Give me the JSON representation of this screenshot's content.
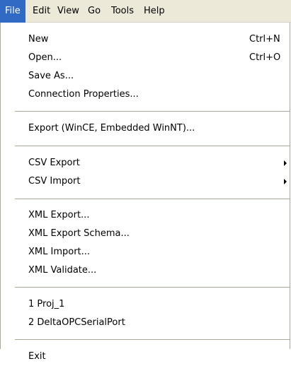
{
  "menubar": {
    "items": [
      {
        "label": "File",
        "active": true
      },
      {
        "label": "Edit"
      },
      {
        "label": "View"
      },
      {
        "label": "Go"
      },
      {
        "label": "Tools"
      },
      {
        "label": "Help"
      }
    ]
  },
  "file_menu": {
    "new": {
      "label": "New",
      "shortcut": "Ctrl+N"
    },
    "open": {
      "label": "Open...",
      "shortcut": "Ctrl+O"
    },
    "save_as": {
      "label": "Save As..."
    },
    "connection_properties": {
      "label": "Connection Properties..."
    },
    "export_wince": {
      "label": "Export (WinCE, Embedded WinNT)..."
    },
    "csv_export": {
      "label": "CSV Export"
    },
    "csv_import": {
      "label": "CSV Import"
    },
    "xml_export": {
      "label": "XML Export..."
    },
    "xml_export_schema": {
      "label": "XML Export Schema..."
    },
    "xml_import": {
      "label": "XML Import..."
    },
    "xml_validate": {
      "label": "XML Validate..."
    },
    "recent_1": {
      "label": "1 Proj_1"
    },
    "recent_2": {
      "label": "2 DeltaOPCSerialPort"
    },
    "exit": {
      "label": "Exit"
    }
  },
  "colors": {
    "highlight": "#316ac5",
    "menubar_bg": "#ece9d8",
    "separator": "#aca899"
  }
}
